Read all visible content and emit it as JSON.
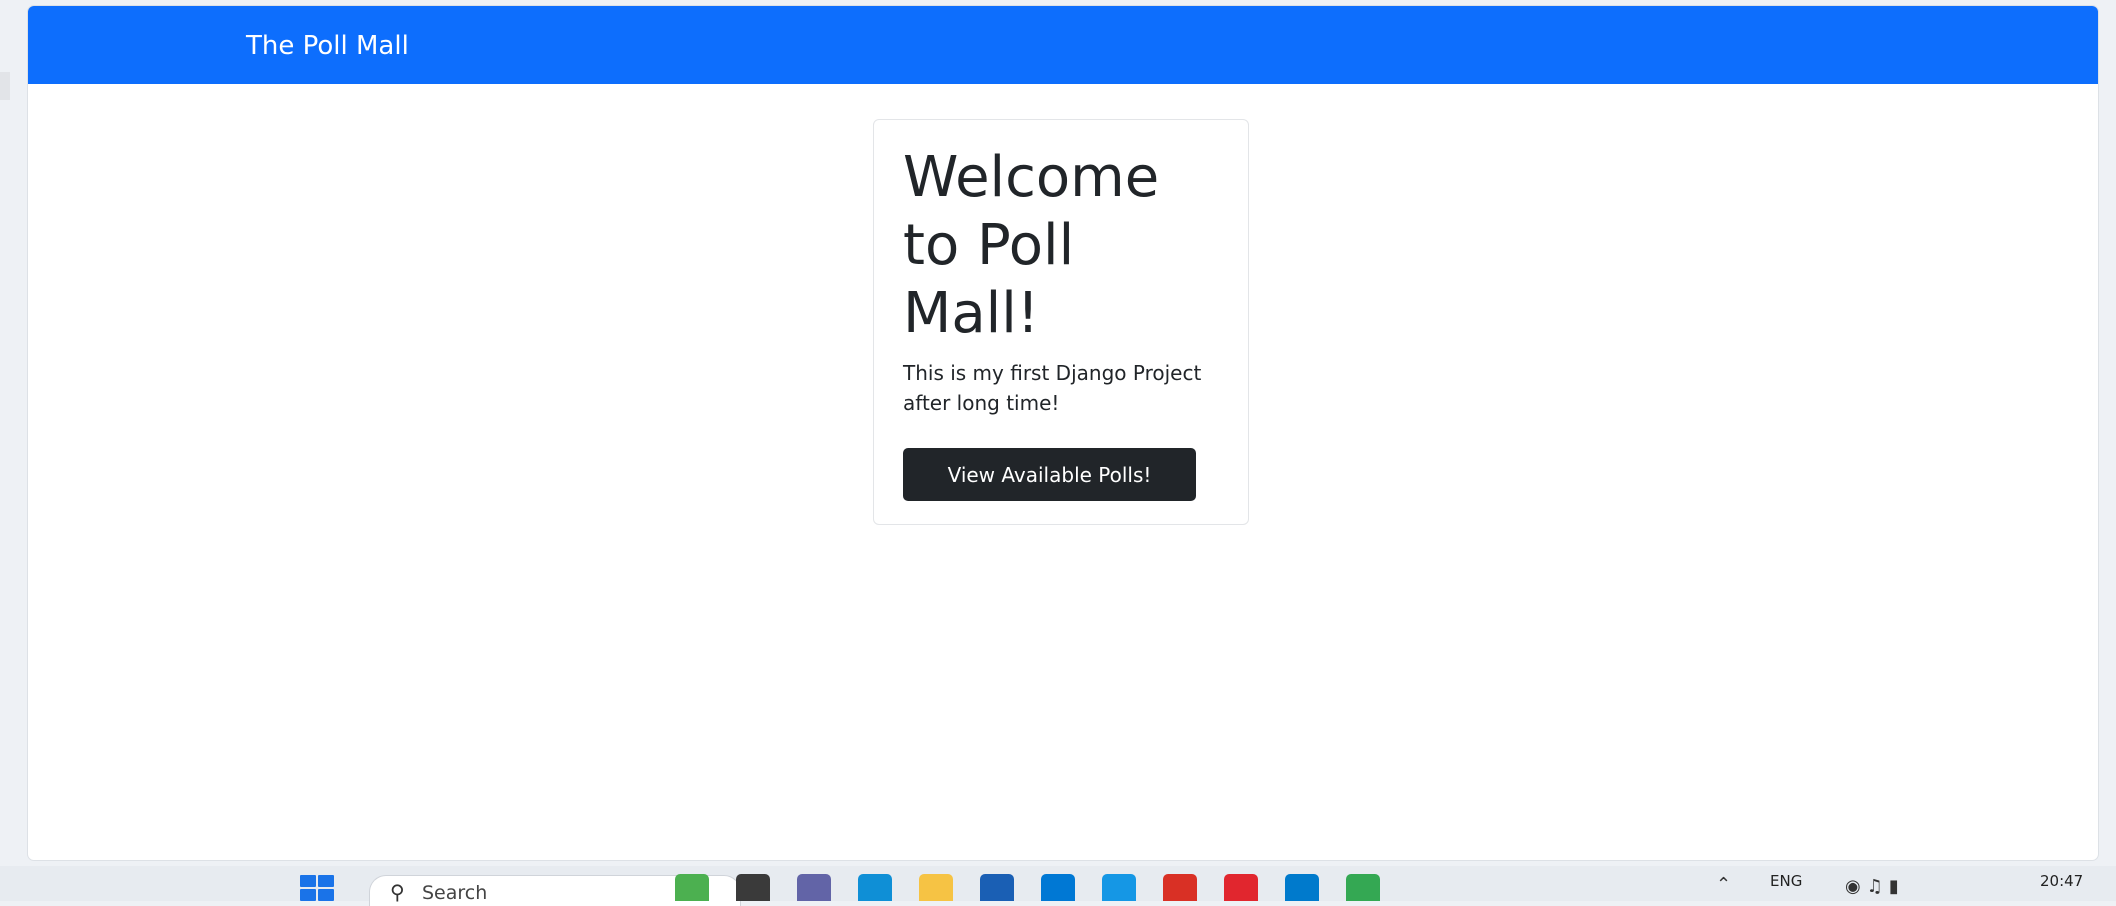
{
  "navbar": {
    "brand": "The Poll Mall",
    "color": "#0d6efd"
  },
  "card": {
    "title": "Welcome to Poll Mall!",
    "text": "This is my first Django Project after long time!",
    "button_label": "View Available Polls!"
  },
  "taskbar": {
    "search_placeholder": "Search",
    "language": "ENG",
    "time": "20:47",
    "pinned_apps": [
      {
        "icon": "widgets-icon",
        "color": "#4cb050"
      },
      {
        "icon": "task-view-icon",
        "color": "#3a3a3a"
      },
      {
        "icon": "teams-chat-icon",
        "color": "#6264a7"
      },
      {
        "icon": "edge-browser-icon",
        "color": "#0f8fd6"
      },
      {
        "icon": "file-explorer-icon",
        "color": "#f6c344"
      },
      {
        "icon": "mail-icon",
        "color": "#1a5fb4"
      },
      {
        "icon": "app-blue-icon",
        "color": "#0078d4"
      },
      {
        "icon": "app-cyan-icon",
        "color": "#1597e5"
      },
      {
        "icon": "gmail-icon",
        "color": "#d93025"
      },
      {
        "icon": "opera-icon",
        "color": "#e1262e"
      },
      {
        "icon": "vscode-icon",
        "color": "#007acc"
      },
      {
        "icon": "chrome-icon",
        "color": "#34a853"
      }
    ]
  }
}
